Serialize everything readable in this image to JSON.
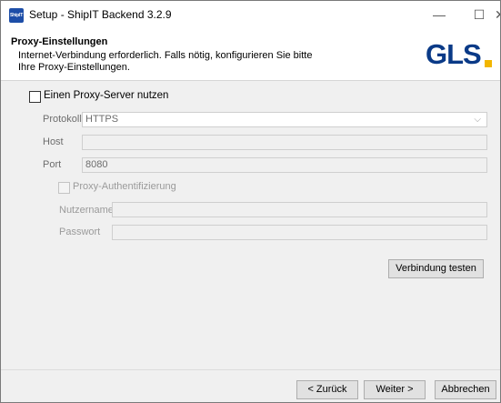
{
  "window": {
    "title": "Setup - ShipIT Backend 3.2.9",
    "app_icon_text": "ShipIT",
    "minimize": "—",
    "maximize": "☐",
    "close": "✕"
  },
  "header": {
    "title": "Proxy-Einstellungen",
    "description": "Internet-Verbindung erforderlich. Falls nötig, konfigurieren Sie bitte Ihre Proxy-Einstellungen.",
    "logo_text": "GLS",
    "logo_colors": {
      "text": "#0a3a87",
      "dot": "#f2b600"
    }
  },
  "proxy": {
    "use_proxy_label": "Einen Proxy-Server nutzen",
    "use_proxy_checked": false,
    "protocol_label": "Protokoll",
    "protocol_value": "HTTPS",
    "host_label": "Host",
    "host_value": "",
    "port_label": "Port",
    "port_value": "8080",
    "auth_label": "Proxy-Authentifizierung",
    "auth_checked": false,
    "username_label": "Nutzername",
    "username_value": "",
    "password_label": "Passwort",
    "password_value": "",
    "test_button": "Verbindung testen"
  },
  "footer": {
    "back_button": "< Zurück",
    "next_button": "Weiter >",
    "cancel_button": "Abbrechen"
  }
}
